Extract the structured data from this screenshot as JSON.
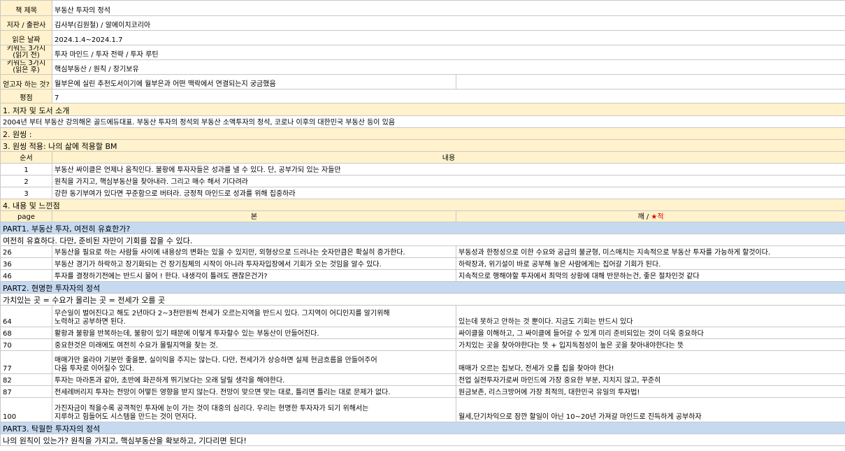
{
  "info": {
    "title_label": "책 제목",
    "title": "부동산 투자의 정석",
    "author_label": "저자 / 출판사",
    "author": "김사부(김원철) / 알에이치코리아",
    "date_label": "읽은 날짜",
    "date": "2024.1.4~2024.1.7",
    "kw1_label": "키워드 3가지 (읽기 전)",
    "kw1": "투자 마인드 / 투자 전략 / 투자 루틴",
    "kw2_label": "키워드 3가지 (읽은 후)",
    "kw2": "핵심부동산 / 원칙 / 장기보유",
    "want_label": "얻고자 하는 것?",
    "want": "월부은에 실린 추천도서이기에 월부은과 어떤 맥락에서 연결되는지 궁금했음",
    "rating_label": "평점",
    "rating": "7"
  },
  "sec1": {
    "title": "1. 저자 및 도서 소개",
    "text": "2004년 부터 부동산 강의해온 골드에듀대표. 부동산 투자의 정석외 부동산 소액투자의 정석, 코로나 이후의 대한민국 부동산 등이 있음"
  },
  "sec2": {
    "title": "2. 원씽 :"
  },
  "sec3": {
    "title": "3. 원씽 적용: 나의 삶에 적용할 BM",
    "col_order": "순서",
    "col_content": "내용",
    "rows": [
      {
        "n": "1",
        "text": "부동산 싸이클은 언제나 움직인다. 불황에 투자자들은 성과를 낼 수 있다. 단, 공부가되 있는 자들만"
      },
      {
        "n": "2",
        "text": "원칙을 가지고, 핵심부동산을 찾아내라. 그리고 매수 해서 기다려라"
      },
      {
        "n": "3",
        "text": "강한 동기부여가 있다면 꾸준함으로 버텨라. 긍정적 마인드로 성과를 위해 집중하라"
      }
    ]
  },
  "sec4": {
    "title": "4. 내용 및 느낀점",
    "col_page": "page",
    "col_bon": "본",
    "col_kkae": "깨 / ",
    "col_star": "★",
    "col_jeok": "적",
    "part1": {
      "title": "PART1. 부동산 투자, 여전히 유효한가?",
      "subtitle": "여전히 유효하다. 다만, 준비된 자만이 기회를 잡을 수 있다.",
      "rows": [
        {
          "page": "26",
          "bon": "부동산을 필요로 하는 사람들 사이에 내용상의 변화는 있을 수 있지만, 외형상으로 드러나는 숫자만큼은 확실히 증가한다.",
          "kkae": "부동성과 한정성으로 이한 수요와 공급의 불균형, 미스매치는 지속적으로 부동산 투자를 가능하게 할것이다."
        },
        {
          "page": "36",
          "bon": "부동산 경기가 하락하고 장기화되는 건 장기침체의 시작이 아니라 투자자입장에서 기회가 오는 것임을 알수 있다.",
          "kkae": "하락장과, 위기설이 바로 공부해 놓은 사람에게는 집어갈 기회가 된다."
        },
        {
          "page": "46",
          "bon": "투자를 결정하기전에는 반드시 물어 ! 한다. 내생각이 틀려도 괜찮은건가?",
          "kkae": "지속적으로 행해야할 투자에서 최악의 상황에 대해 반문하는건, 좋은 절차인것 같다"
        }
      ]
    },
    "part2": {
      "title": "PART2. 현명한 투자자의 정석",
      "subtitle": "가치있는 곳 = 수요가 몰리는 곳 = 전세가 오를 곳",
      "rows": [
        {
          "page": "64",
          "bon1": "무슨일이 벌어진다고 해도 2년마다 2~3천만원씩 전세가 오르는지역을 반드시 있다. 그지역이 어디인지를 알기위해",
          "bon2": "노력하고 공부하면 된다.",
          "kkae": "있는데 못하고 안하는 것 뿐이다. 지금도 기회는 반드시 있다"
        },
        {
          "page": "68",
          "bon": "활황과 불황을 반복하는데, 불황이 있기 때문에 이렇게 투자할수 있는 부동산이 만들어진다.",
          "kkae": "싸이클을 이해하고, 그 싸이클에 들어갈 수 있게 미리 준비되있는 것이 더욱 중요하다"
        },
        {
          "page": "70",
          "bon": "중요한것은 미래에도 여전히 수요가 몰릴지역을 찾는 것.",
          "kkae": "가치있는 곳을 찾아야한다는 뜻 + 입지독점성이 높은 곳을 찾아내야한다는 뜻"
        },
        {
          "page": "77",
          "bon1": "매매가만 올라야 기분만 좋을뿐, 실이익을 주지는 않는다. 다만, 전세가가 상승하면 실제 현금흐름을 만들어주어",
          "bon2": "다음 투자로 이어질수 있다.",
          "kkae": "매매가 오르는 집보다, 전세가 오를 집을 찾아야 한다!"
        },
        {
          "page": "82",
          "bon": "투자는 마라톤과 같아, 초반에 화끈하게 뛰기보다는 오래 달릴 생각을 해야한다.",
          "kkae": "전업 실전투자가로써 마인드에 가장 중요한 부분, 지치지 않고, 꾸준히"
        },
        {
          "page": "87",
          "bon": "전세레버리지 투자는 전망이 어떻든 영향을 받지 않는다. 전망이 맞으면 맞는 대로, 틀리면 틀리는 대로 문제가 없다.",
          "kkae": "원금보존, 리스크방어에 가장 최적의, 대한민국 유일의 투자법!"
        },
        {
          "page": "100",
          "bon1": "가진자금이 적을수록 공격적인 투자에 눈이 가는 것이 대중의 심리다. 우리는 현명한 투자자가 되기 위해서는",
          "bon2": "지루하고 힘들어도 시스템을 만드는 것이 먼저다.",
          "kkae": "월세,단기차익으로 잠깐 할일이 아닌 10~20년 가져갈 마인드로 진득하게 공부하자"
        }
      ]
    },
    "part3": {
      "title": "PART3. 탁월한 투자자의 정석",
      "subtitle": "나의 원칙이 있는가? 원칙을 가지고, 핵심부동산을 확보하고, 기다리면 된다!"
    }
  },
  "colors": {
    "header_bg": "#fff2cc",
    "part_bg": "#c5d9f1",
    "grid": "#c8c8c8",
    "star": "#e00000"
  }
}
